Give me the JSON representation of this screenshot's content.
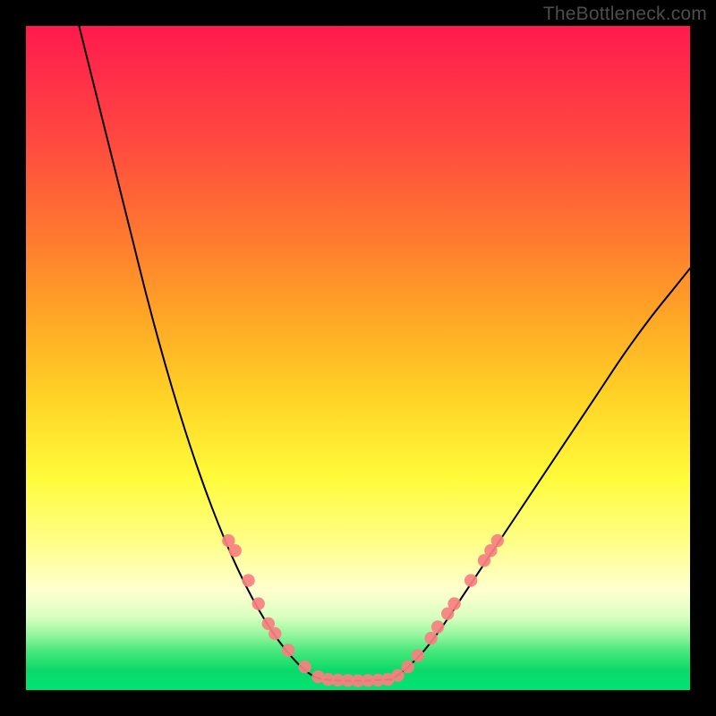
{
  "watermark": "TheBottleneck.com",
  "chart_data": {
    "type": "line",
    "title": "",
    "xlabel": "",
    "ylabel": "",
    "xlim": [
      0,
      100
    ],
    "ylim": [
      0,
      100
    ],
    "grid": false,
    "legend": false,
    "series": [
      {
        "name": "left-curve",
        "x": [
          8,
          10,
          12,
          14,
          16,
          18,
          20,
          22,
          24,
          26,
          28,
          30,
          32,
          34,
          36,
          38,
          40,
          42,
          43.5,
          45
        ],
        "y": [
          100,
          92,
          84,
          76,
          68,
          60,
          52.5,
          45.5,
          39,
          33,
          27.5,
          22.5,
          18,
          14,
          10.5,
          7.5,
          5,
          3,
          2,
          1.6
        ]
      },
      {
        "name": "flat-bottom",
        "x": [
          45,
          46,
          47,
          48,
          49,
          50,
          51,
          52,
          53,
          54,
          55
        ],
        "y": [
          1.6,
          1.5,
          1.45,
          1.4,
          1.4,
          1.4,
          1.4,
          1.45,
          1.5,
          1.55,
          1.6
        ]
      },
      {
        "name": "right-curve",
        "x": [
          55,
          57,
          60,
          63,
          66,
          70,
          74,
          78,
          82,
          86,
          90,
          94,
          98,
          100
        ],
        "y": [
          1.6,
          3,
          6,
          10,
          14.5,
          20.5,
          26.5,
          32.5,
          38.5,
          44.5,
          50.5,
          56,
          61,
          63.5
        ]
      }
    ],
    "markers": {
      "note": "salmon/pink scatter markers overlaid near the bottom of both curve arms and along the trough",
      "color": "#f88080",
      "points": [
        {
          "x": 30.5,
          "y": 22.5
        },
        {
          "x": 31.5,
          "y": 21
        },
        {
          "x": 33.5,
          "y": 16.5
        },
        {
          "x": 35,
          "y": 13
        },
        {
          "x": 36.5,
          "y": 10
        },
        {
          "x": 37.5,
          "y": 8.5
        },
        {
          "x": 39.5,
          "y": 6
        },
        {
          "x": 42,
          "y": 3.5
        },
        {
          "x": 44,
          "y": 2
        },
        {
          "x": 45.5,
          "y": 1.6
        },
        {
          "x": 47,
          "y": 1.5
        },
        {
          "x": 48.5,
          "y": 1.45
        },
        {
          "x": 50,
          "y": 1.4
        },
        {
          "x": 51.5,
          "y": 1.45
        },
        {
          "x": 53,
          "y": 1.5
        },
        {
          "x": 54.5,
          "y": 1.6
        },
        {
          "x": 56,
          "y": 2.2
        },
        {
          "x": 57.5,
          "y": 3.5
        },
        {
          "x": 59,
          "y": 5.2
        },
        {
          "x": 61,
          "y": 7.8
        },
        {
          "x": 62,
          "y": 9.5
        },
        {
          "x": 63.5,
          "y": 11.5
        },
        {
          "x": 64.5,
          "y": 13
        },
        {
          "x": 67,
          "y": 16.5
        },
        {
          "x": 69,
          "y": 19.5
        },
        {
          "x": 70,
          "y": 21
        },
        {
          "x": 71,
          "y": 22.5
        }
      ]
    }
  }
}
